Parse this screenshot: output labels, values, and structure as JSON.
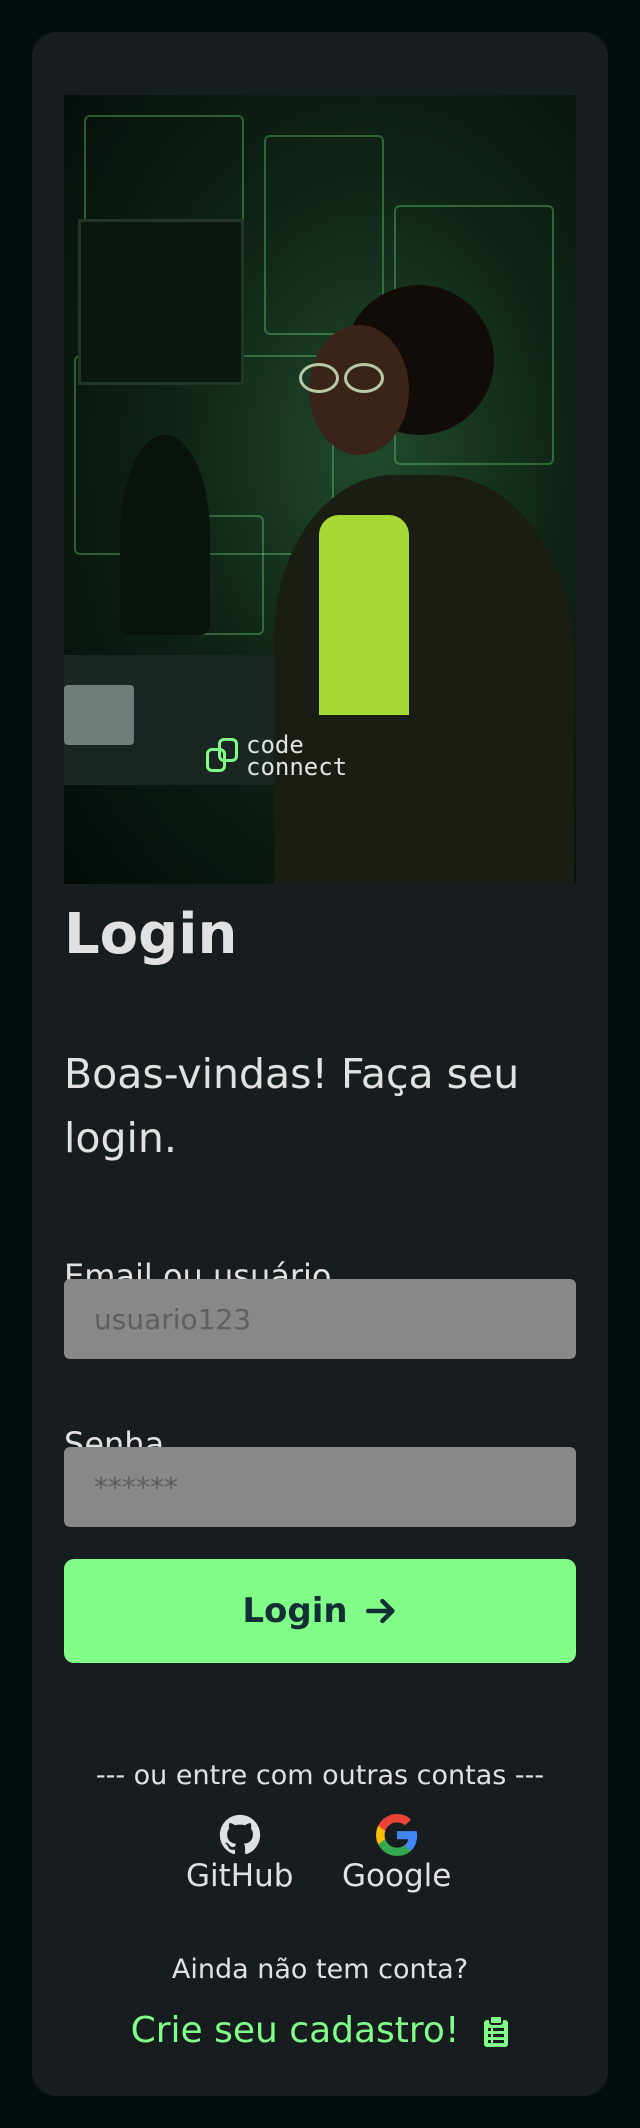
{
  "hero": {
    "logo_line1": "code",
    "logo_line2": "connect"
  },
  "form": {
    "title": "Login",
    "subtitle": "Boas-vindas! Faça seu login.",
    "email_label": "Email ou usuário",
    "email_placeholder": "usuario123",
    "password_label": "Senha",
    "password_placeholder": "******",
    "submit_label": "Login"
  },
  "social": {
    "divider": "--- ou entre com outras contas ---",
    "providers": [
      {
        "label": "GitHub",
        "icon": "github-icon"
      },
      {
        "label": "Google",
        "icon": "google-icon"
      }
    ]
  },
  "signup": {
    "prompt": "Ainda não tem conta?",
    "link_label": "Crie seu cadastro!",
    "icon": "clipboard-icon"
  },
  "colors": {
    "page_bg": "#050c10",
    "card_bg": "#171d1f",
    "accent": "#81fe88",
    "input_bg": "#888888",
    "text": "#e1e1e1"
  }
}
